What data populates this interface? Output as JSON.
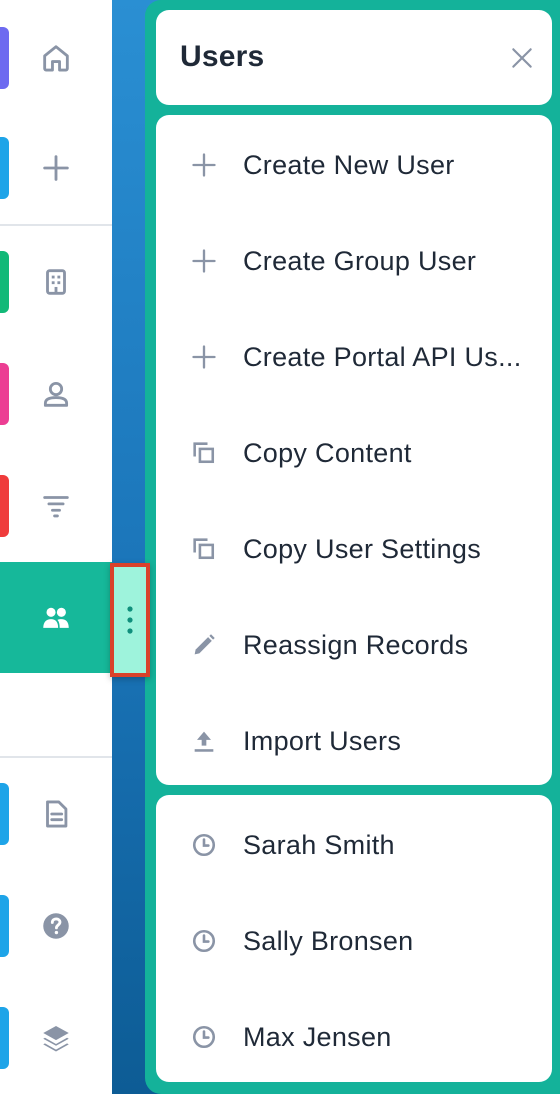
{
  "nav_rail": {
    "items": [
      {
        "name": "home",
        "icon": "home-icon",
        "accent": "#6d6af0"
      },
      {
        "name": "create",
        "icon": "plus-icon",
        "accent": "#1ea4e8"
      },
      {
        "name": "accounts",
        "icon": "building-icon",
        "accent": "#12b978"
      },
      {
        "name": "contacts",
        "icon": "person-icon",
        "accent": "#ec3e93"
      },
      {
        "name": "leads",
        "icon": "filter-icon",
        "accent": "#ef3b3b"
      },
      {
        "name": "users",
        "icon": "users-icon",
        "accent": "#16b89a",
        "active": true
      },
      {
        "name": "documents",
        "icon": "document-icon",
        "accent": "#1ea4e8"
      },
      {
        "name": "help",
        "icon": "help-icon",
        "accent": "#1ea4e8"
      },
      {
        "name": "layers",
        "icon": "layers-icon",
        "accent": "#1ea4e8"
      }
    ]
  },
  "panel": {
    "title": "Users",
    "close_icon": "close-icon",
    "actions": [
      {
        "label": "Create New User",
        "icon": "plus-icon"
      },
      {
        "label": "Create Group User",
        "icon": "plus-icon"
      },
      {
        "label": "Create Portal API Us...",
        "icon": "plus-icon"
      },
      {
        "label": "Copy Content",
        "icon": "copy-icon"
      },
      {
        "label": "Copy User Settings",
        "icon": "copy-icon"
      },
      {
        "label": "Reassign Records",
        "icon": "pencil-icon"
      },
      {
        "label": "Import Users",
        "icon": "upload-icon"
      }
    ],
    "recent": [
      {
        "label": "Sarah Smith",
        "icon": "clock-icon"
      },
      {
        "label": "Sally Bronsen",
        "icon": "clock-icon"
      },
      {
        "label": "Max Jensen",
        "icon": "clock-icon"
      }
    ]
  },
  "colors": {
    "panel_bg": "#14b29a",
    "active_nav": "#16b89a",
    "handle_bg": "#9ef3dc",
    "handle_border": "#d9412b",
    "icon_gray": "#8a94a6",
    "text": "#1f2937"
  }
}
